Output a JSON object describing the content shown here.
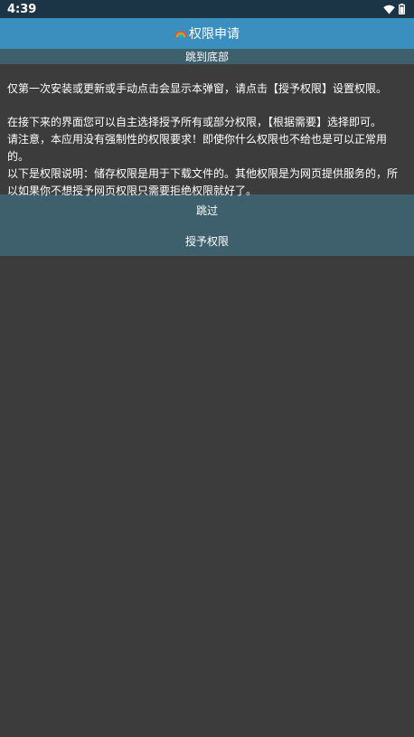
{
  "status_bar": {
    "time": "4:39",
    "icons": [
      "wifi-icon",
      "battery-icon"
    ]
  },
  "header": {
    "icon": "rainbow-icon",
    "title": "权限申请"
  },
  "jump_link": "跳到底部",
  "body": {
    "para1": "仅第一次安装或更新或手动点击会显示本弹窗，请点击【授予权限】设置权限。",
    "para2_line1": "在接下来的界面您可以自主选择授予所有或部分权限，【根据需要】选择即可。",
    "para2_line2": "请注意，本应用没有强制性的权限要求！即使你什么权限也不给也是可以正常用的。",
    "para2_line3": "以下是权限说明：储存权限是用于下载文件的。其他权限是为网页提供服务的，所以如果你不想授予网页权限只需要拒绝权限就好了。"
  },
  "buttons": {
    "skip": "跳过",
    "grant": "授予权限"
  }
}
